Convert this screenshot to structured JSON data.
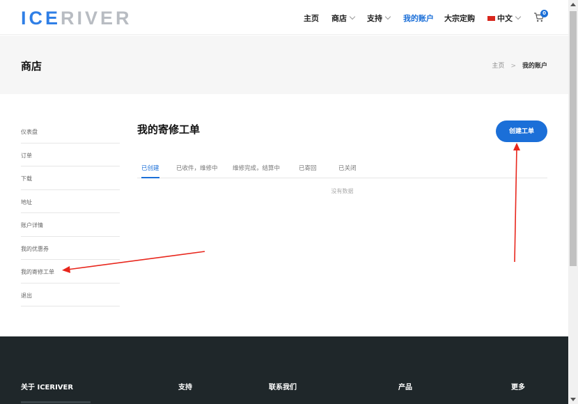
{
  "brand": {
    "logo_ice": "ICE",
    "logo_river": "RIVER"
  },
  "nav": {
    "home": "主页",
    "shop": "商店",
    "support": "支持",
    "account": "我的账户",
    "bulk": "大宗定购",
    "language": "中文",
    "cart_count": "0"
  },
  "page": {
    "title": "商店"
  },
  "breadcrumb": {
    "home": "主页",
    "separator": ">",
    "current": "我的账户"
  },
  "sidebar": {
    "items": [
      {
        "label": "仪表盘"
      },
      {
        "label": "订单"
      },
      {
        "label": "下载"
      },
      {
        "label": "地址"
      },
      {
        "label": "账户详情"
      },
      {
        "label": "我的优惠券"
      },
      {
        "label": "我的寄修工单"
      },
      {
        "label": "退出"
      }
    ]
  },
  "main": {
    "title": "我的寄修工单",
    "create_button": "创建工单",
    "tabs": [
      {
        "label": "已创建",
        "active": true
      },
      {
        "label": "已收件，维修中",
        "active": false
      },
      {
        "label": "维修完成，结算中",
        "active": false
      },
      {
        "label": "已寄回",
        "active": false
      },
      {
        "label": "已关闭",
        "active": false
      }
    ],
    "empty_text": "没有数据"
  },
  "footer": {
    "columns": [
      {
        "title": "关于 ICERIVER"
      },
      {
        "title": "支持"
      },
      {
        "title": "联系我们"
      },
      {
        "title": "产品"
      },
      {
        "title": "更多"
      }
    ]
  },
  "colors": {
    "accent": "#1b6fd8",
    "footer_bg": "#1f272a",
    "annotation": "#e8261c"
  },
  "icons": {
    "cart": "shopping-cart-icon",
    "flag": "china-flag-icon",
    "dropdown": "chevron-down-icon"
  }
}
